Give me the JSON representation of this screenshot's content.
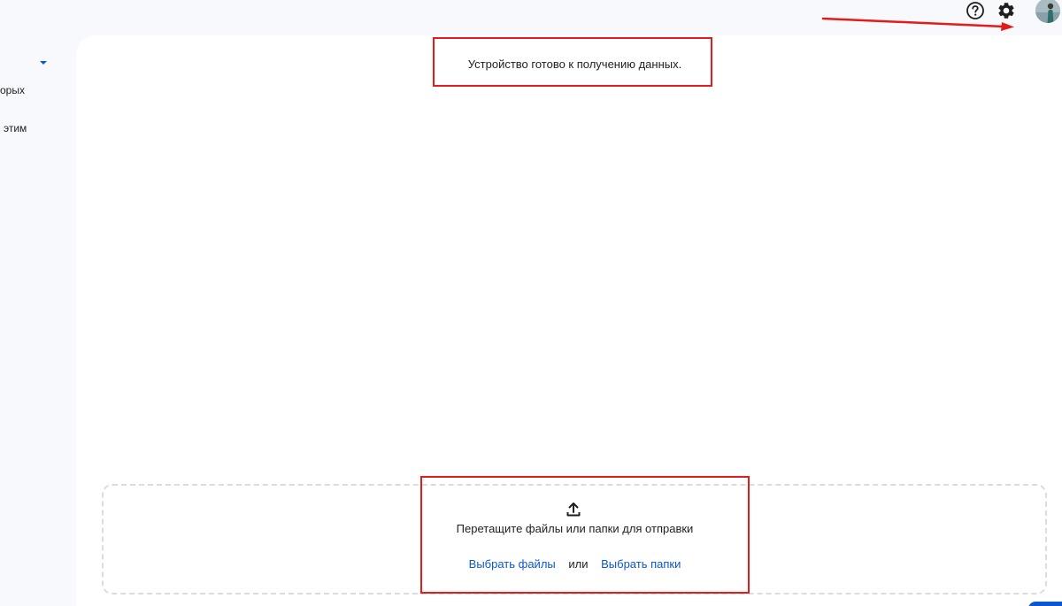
{
  "sidebar": {
    "text_fragment_1": "орых",
    "text_fragment_2": "этим"
  },
  "main": {
    "status": "Устройство готово к получению данных.",
    "dropzone": {
      "hint": "Перетащите файлы или папки для отправки",
      "choose_files": "Выбрать файлы",
      "or": "или",
      "choose_folders": "Выбрать папки"
    }
  },
  "icons": {
    "help": "help-icon",
    "settings": "gear-icon",
    "upload": "upload-icon",
    "caret": "caret-down-icon"
  },
  "colors": {
    "link": "#0b57d0",
    "annotation": "#e31b1b",
    "background": "#f8f9fc",
    "panel": "#ffffff"
  }
}
